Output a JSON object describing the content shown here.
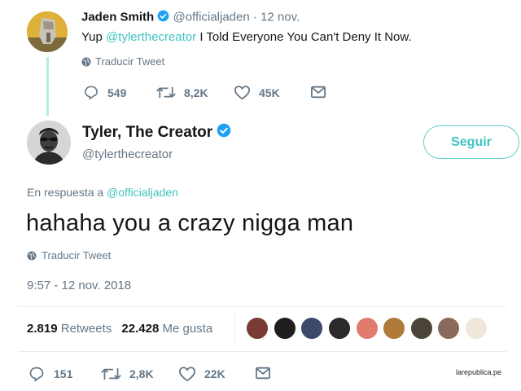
{
  "parent_tweet": {
    "author_name": "Jaden Smith",
    "handle": "@officialjaden",
    "date": "· 12 nov.",
    "text_prefix": "Yup",
    "mention": "@tylerthecreator",
    "text_suffix": "I Told Everyone You Can't Deny It Now.",
    "translate_label": "Traducir Tweet",
    "replies": "549",
    "retweets": "8,2K",
    "likes": "45K"
  },
  "main_tweet": {
    "author_name": "Tyler, The Creator",
    "handle": "@tylerthecreator",
    "follow_label": "Seguir",
    "reply_to_prefix": "En respuesta a",
    "reply_to_handle": "@officialjaden",
    "text": "hahaha you a crazy nigga man",
    "translate_label": "Traducir Tweet",
    "timestamp": "9:57 - 12 nov. 2018",
    "retweets_count": "2.819",
    "retweets_label": "Retweets",
    "likes_count": "22.428",
    "likes_label": "Me gusta",
    "replies": "151",
    "retweets": "2,8K",
    "likes": "22K"
  },
  "watermark": "larepublica.pe",
  "colors": {
    "accent": "#3fc3c0",
    "verified": "#1da1f2",
    "muted": "#657786",
    "thread_line": "#b5ece8"
  },
  "icons": {
    "verified": "verified-badge-icon",
    "globe": "globe-icon",
    "reply": "reply-icon",
    "retweet": "retweet-icon",
    "like": "heart-icon",
    "dm": "envelope-icon"
  }
}
